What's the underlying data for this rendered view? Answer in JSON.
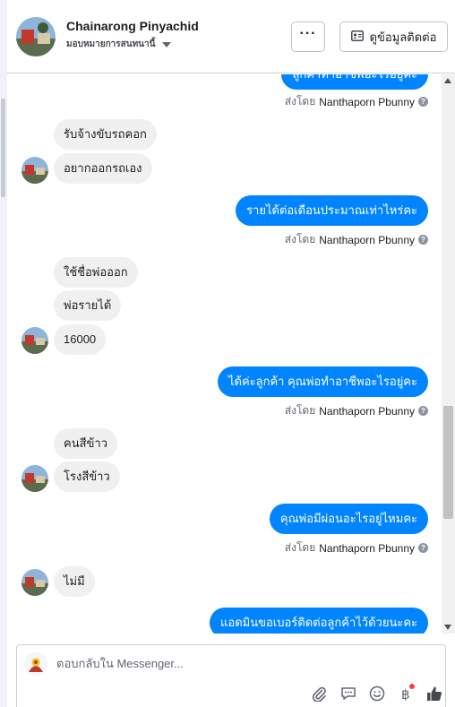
{
  "header": {
    "contact_name": "Chainarong Pinyachid",
    "assign_label": "มอบหมายการสนทนานี้",
    "more_button_label": "···",
    "contact_info_label": "ดูข้อมูลติดต่อ"
  },
  "colors": {
    "accent": "#0084ff",
    "incoming_bubble": "#f0f0f0",
    "notification": "#fa3e3e"
  },
  "messages": [
    {
      "dir": "out",
      "text": "ลูกค้าทำอาชีพอะไรอยู่คะ",
      "partial": true
    },
    {
      "dir": "meta",
      "prefix": "ส่งโดย",
      "sender": "Nanthaporn Pbunny"
    },
    {
      "dir": "in",
      "text": "รับจ้างขับรถคอก"
    },
    {
      "dir": "in",
      "text": "อยากออกรถเอง"
    },
    {
      "dir": "out",
      "text": "รายได้ต่อเดือนประมาณเท่าไหร่คะ"
    },
    {
      "dir": "meta",
      "prefix": "ส่งโดย",
      "sender": "Nanthaporn Pbunny"
    },
    {
      "dir": "in",
      "text": "ใช้ชื่อพ่อออก"
    },
    {
      "dir": "in",
      "text": "พ่อรายได้"
    },
    {
      "dir": "in",
      "text": "16000"
    },
    {
      "dir": "out",
      "text": "ได้ค่ะลูกค้า คุณพ่อทำอาชีพอะไรอยู่คะ"
    },
    {
      "dir": "meta",
      "prefix": "ส่งโดย",
      "sender": "Nanthaporn Pbunny"
    },
    {
      "dir": "in",
      "text": "คนสีข้าว"
    },
    {
      "dir": "in",
      "text": "โรงสีข้าว"
    },
    {
      "dir": "out",
      "text": "คุณพ่อมีผ่อนอะไรอยู่ไหมคะ"
    },
    {
      "dir": "meta",
      "prefix": "ส่งโดย",
      "sender": "Nanthaporn Pbunny"
    },
    {
      "dir": "in",
      "text": "ไม่มี"
    },
    {
      "dir": "out",
      "text": "แอดมินขอเบอร์ติดต่อลูกค้าไว้ด้วยนะคะ",
      "partial": true
    }
  ],
  "composer": {
    "placeholder": "ตอบกลับใน Messenger...",
    "tools": [
      "paperclip-icon",
      "saved-reply-icon",
      "emoji-icon",
      "baht-icon",
      "thumbs-up-icon"
    ]
  }
}
